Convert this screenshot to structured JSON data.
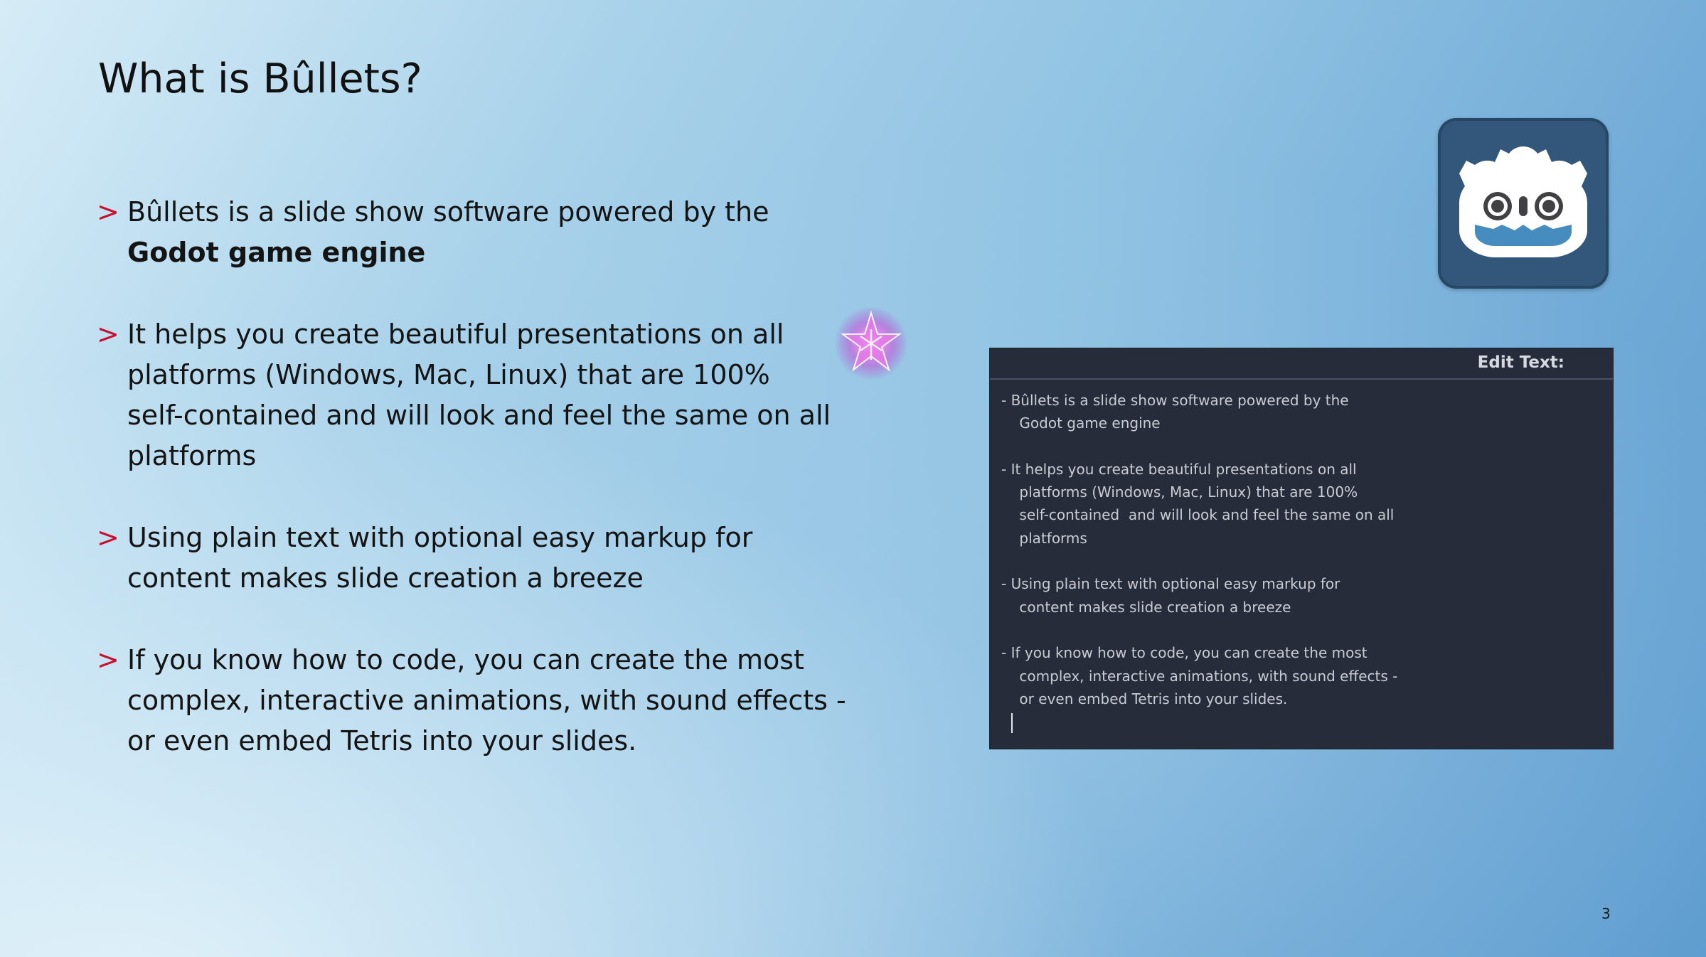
{
  "slide": {
    "title": "What is Bûllets?",
    "page_number": "3"
  },
  "bullets": [
    {
      "marker": ">",
      "lines": [
        "Bûllets is a slide show software powered by the"
      ],
      "bold_line": "Godot game engine"
    },
    {
      "marker": ">",
      "lines": [
        "It helps you create beautiful presentations on all",
        "platforms (Windows, Mac, Linux) that are 100%",
        "self-contained  and will look and feel the same on all",
        "platforms"
      ]
    },
    {
      "marker": ">",
      "lines": [
        "Using plain text with optional easy markup for",
        "content makes slide creation a breeze"
      ]
    },
    {
      "marker": ">",
      "lines": [
        "If you know how to code, you can create the most",
        "complex, interactive animations, with sound effects -",
        "or even embed Tetris into your slides."
      ]
    }
  ],
  "editor": {
    "title": "Edit Text:",
    "lines": [
      "- Bûllets is a slide show software powered by the",
      "    Godot game engine",
      "",
      "- It helps you create beautiful presentations on all",
      "    platforms (Windows, Mac, Linux) that are 100%",
      "    self-contained  and will look and feel the same on all",
      "    platforms",
      "",
      "- Using plain text with optional easy markup for",
      "    content makes slide creation a breeze",
      "",
      "- If you know how to code, you can create the most",
      "    complex, interactive animations, with sound effects -",
      "    or even embed Tetris into your slides."
    ]
  },
  "icons": {
    "logo": "godot-logo-icon",
    "sparkle": "sparkle-star-icon"
  },
  "colors": {
    "bullet_marker": "#c8102e",
    "editor_bg": "#272c3a",
    "logo_bg": "#33577b"
  }
}
